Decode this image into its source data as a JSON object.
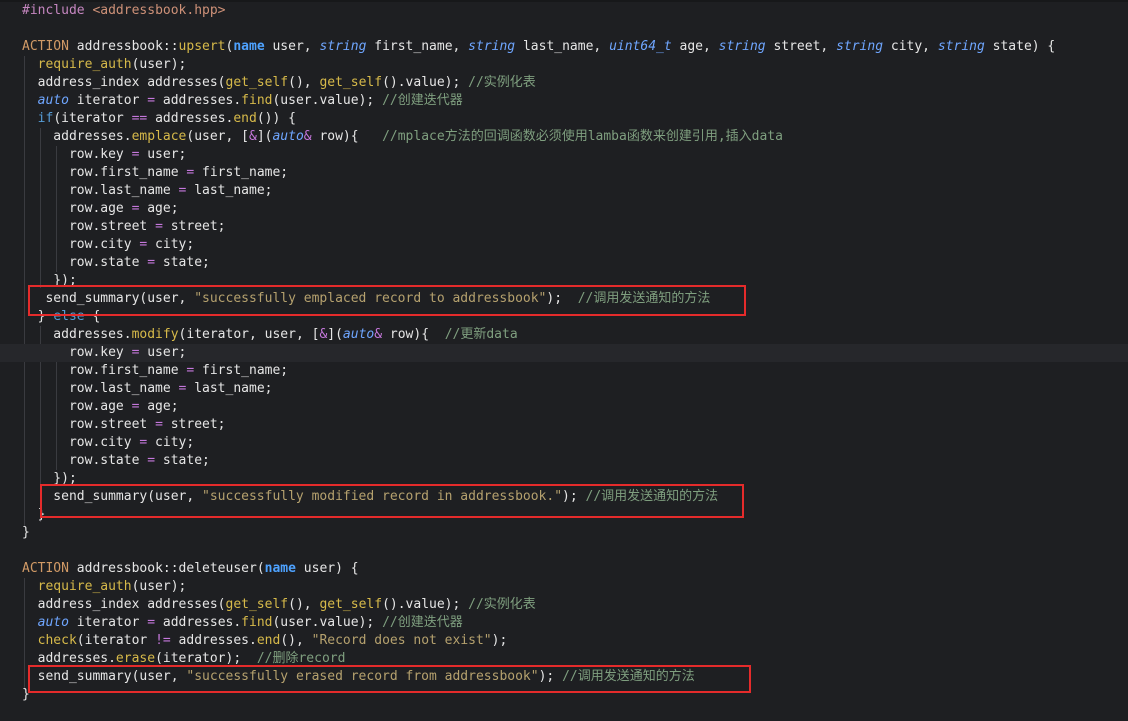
{
  "code": {
    "include_directive": "#include",
    "include_file": "<addressbook.hpp>",
    "action_macro": "ACTION",
    "class_scope": "addressbook::",
    "upsert_fn": "upsert",
    "upsert_params": "(name user, string first_name, string last_name, uint64_t age, string street, string city, string state) {",
    "name_type": "name",
    "string_type": "string",
    "uint64_type": "uint64_t",
    "auto_type": "auto",
    "require_auth": "require_auth",
    "get_self": "get_self",
    "find": "find",
    "end": "end",
    "emplace": "emplace",
    "modify": "modify",
    "erase": "erase",
    "check": "check",
    "comment_instance": "//实例化表",
    "comment_iterator": "//创建迭代器",
    "comment_emplace": "//mplace方法的回调函数必须使用lamba函数来创建引用,插入data",
    "comment_notify": "//调用发送通知的方法",
    "comment_update": "//更新data",
    "comment_delete": "//删除record",
    "str_emplaced": "\"successfully emplaced record to addressbook\"",
    "str_modified": "\"successfully modified record in addressbook.\"",
    "str_erased": "\"successfully erased record from addressbook\"",
    "str_not_exist": "\"Record does not exist\"",
    "deleteuser_fn": "deleteuser"
  },
  "colors": {
    "background": "#1e1f22",
    "highlight_box": "#e52b2b",
    "comment": "#7f9f7f",
    "string": "#b5a16e",
    "function": "#d7ba4a"
  }
}
